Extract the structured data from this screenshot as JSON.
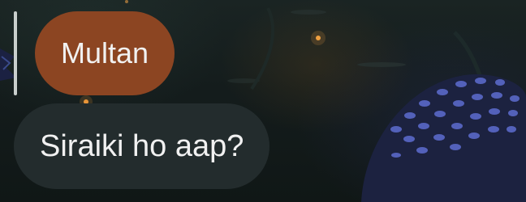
{
  "chat": {
    "quoted_message": {
      "text": "Multan",
      "background_color": "#8c4522"
    },
    "message": {
      "text": "Siraiki ho aap?",
      "background_color": "#232c2d"
    },
    "reply_indicator_color": "#c9cfcd",
    "wallpaper": {
      "description_icon": "night-mushroom-wallpaper",
      "firefly_color": "#f0a040",
      "mushroom_color": "#5a68c8"
    }
  }
}
